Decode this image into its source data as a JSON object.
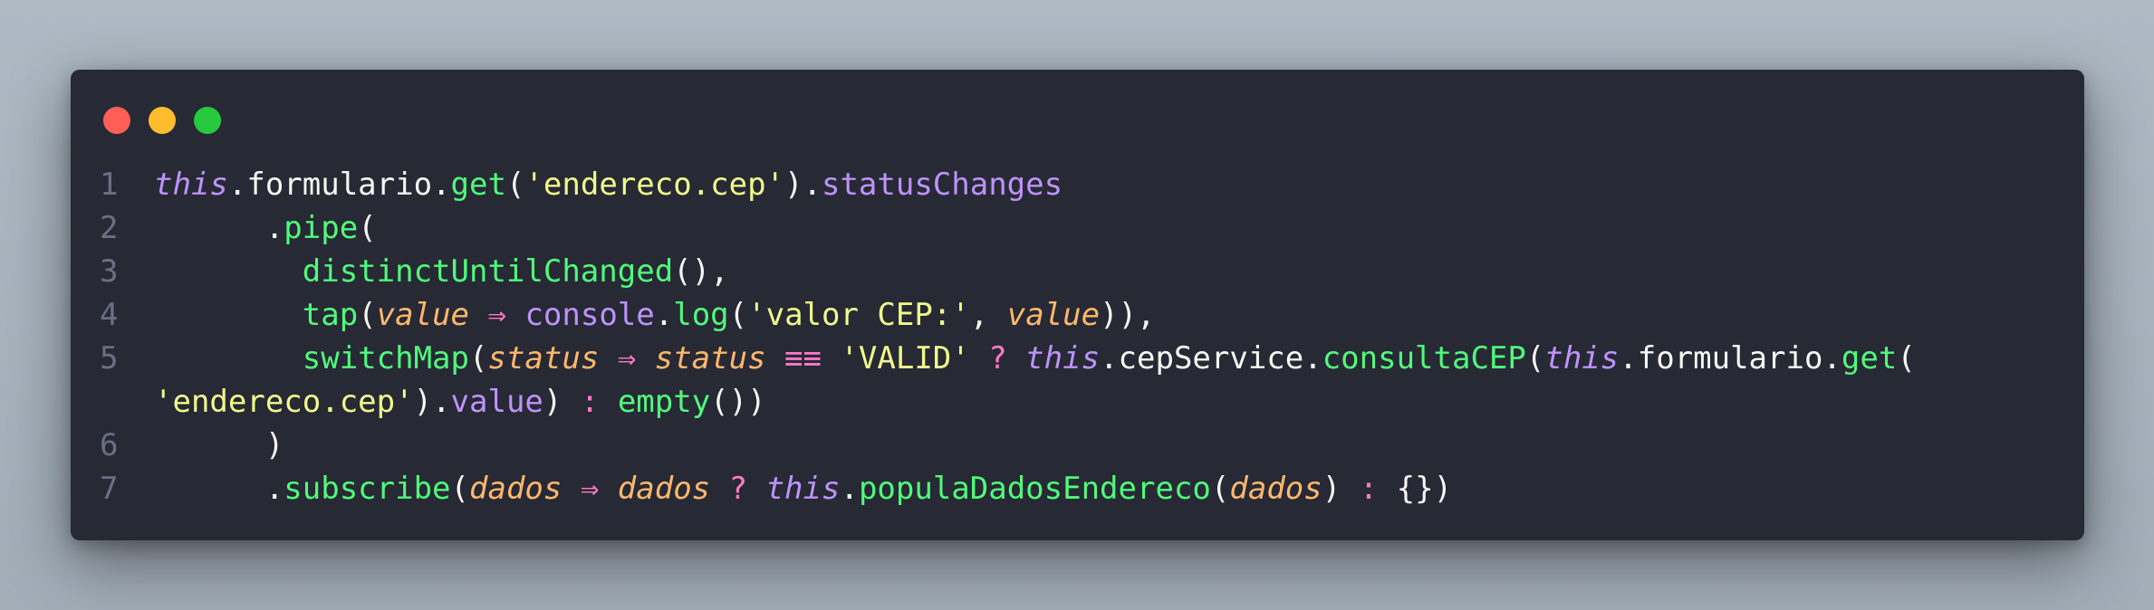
{
  "window": {
    "controls": [
      "close",
      "minimize",
      "maximize"
    ],
    "colors": {
      "background": "#272935",
      "close": "#ff5f56",
      "minimize": "#ffbd2e",
      "maximize": "#27c93f"
    }
  },
  "code": {
    "lines": [
      {
        "number": "1",
        "tokens": [
          {
            "cls": "kw-this",
            "text": "this"
          },
          {
            "cls": "punc",
            "text": ".formulario."
          },
          {
            "cls": "fn",
            "text": "get"
          },
          {
            "cls": "punc",
            "text": "("
          },
          {
            "cls": "str",
            "text": "'endereco.cep'"
          },
          {
            "cls": "punc",
            "text": ")."
          },
          {
            "cls": "prop",
            "text": "statusChanges"
          }
        ]
      },
      {
        "number": "2",
        "tokens": [
          {
            "cls": "punc",
            "text": "      ."
          },
          {
            "cls": "fn",
            "text": "pipe"
          },
          {
            "cls": "punc",
            "text": "("
          }
        ]
      },
      {
        "number": "3",
        "tokens": [
          {
            "cls": "punc",
            "text": "        "
          },
          {
            "cls": "fn",
            "text": "distinctUntilChanged"
          },
          {
            "cls": "punc",
            "text": "(),"
          }
        ]
      },
      {
        "number": "4",
        "tokens": [
          {
            "cls": "punc",
            "text": "        "
          },
          {
            "cls": "fn",
            "text": "tap"
          },
          {
            "cls": "punc",
            "text": "("
          },
          {
            "cls": "param",
            "text": "value"
          },
          {
            "cls": "op",
            "text": " ⇒ "
          },
          {
            "cls": "prop",
            "text": "console"
          },
          {
            "cls": "punc",
            "text": "."
          },
          {
            "cls": "fn",
            "text": "log"
          },
          {
            "cls": "punc",
            "text": "("
          },
          {
            "cls": "str",
            "text": "'valor CEP:'"
          },
          {
            "cls": "punc",
            "text": ", "
          },
          {
            "cls": "param",
            "text": "value"
          },
          {
            "cls": "punc",
            "text": ")),"
          }
        ]
      },
      {
        "number": "5",
        "tokens": [
          {
            "cls": "punc",
            "text": "        "
          },
          {
            "cls": "fn",
            "text": "switchMap"
          },
          {
            "cls": "punc",
            "text": "("
          },
          {
            "cls": "param",
            "text": "status"
          },
          {
            "cls": "op",
            "text": " ⇒ "
          },
          {
            "cls": "param",
            "text": "status"
          },
          {
            "cls": "op",
            "text": " ≡≡ "
          },
          {
            "cls": "str",
            "text": "'VALID'"
          },
          {
            "cls": "op",
            "text": " ? "
          },
          {
            "cls": "kw-this",
            "text": "this"
          },
          {
            "cls": "punc",
            "text": ".cepService."
          },
          {
            "cls": "fn",
            "text": "consultaCEP"
          },
          {
            "cls": "punc",
            "text": "("
          },
          {
            "cls": "kw-this",
            "text": "this"
          },
          {
            "cls": "punc",
            "text": ".formulario."
          },
          {
            "cls": "fn",
            "text": "get"
          },
          {
            "cls": "punc",
            "text": "("
          }
        ]
      },
      {
        "number": "",
        "tokens": [
          {
            "cls": "str",
            "text": "'endereco.cep'"
          },
          {
            "cls": "punc",
            "text": ")."
          },
          {
            "cls": "prop",
            "text": "value"
          },
          {
            "cls": "punc",
            "text": ") "
          },
          {
            "cls": "op",
            "text": ":"
          },
          {
            "cls": "punc",
            "text": " "
          },
          {
            "cls": "fn",
            "text": "empty"
          },
          {
            "cls": "punc",
            "text": "())"
          }
        ]
      },
      {
        "number": "6",
        "tokens": [
          {
            "cls": "punc",
            "text": "      )"
          }
        ]
      },
      {
        "number": "7",
        "tokens": [
          {
            "cls": "punc",
            "text": "      ."
          },
          {
            "cls": "fn",
            "text": "subscribe"
          },
          {
            "cls": "punc",
            "text": "("
          },
          {
            "cls": "param",
            "text": "dados"
          },
          {
            "cls": "op",
            "text": " ⇒ "
          },
          {
            "cls": "param",
            "text": "dados"
          },
          {
            "cls": "op",
            "text": " ? "
          },
          {
            "cls": "kw-this",
            "text": "this"
          },
          {
            "cls": "punc",
            "text": "."
          },
          {
            "cls": "fn",
            "text": "populaDadosEndereco"
          },
          {
            "cls": "punc",
            "text": "("
          },
          {
            "cls": "param",
            "text": "dados"
          },
          {
            "cls": "punc",
            "text": ") "
          },
          {
            "cls": "op",
            "text": ":"
          },
          {
            "cls": "punc",
            "text": " {})"
          }
        ]
      }
    ]
  }
}
